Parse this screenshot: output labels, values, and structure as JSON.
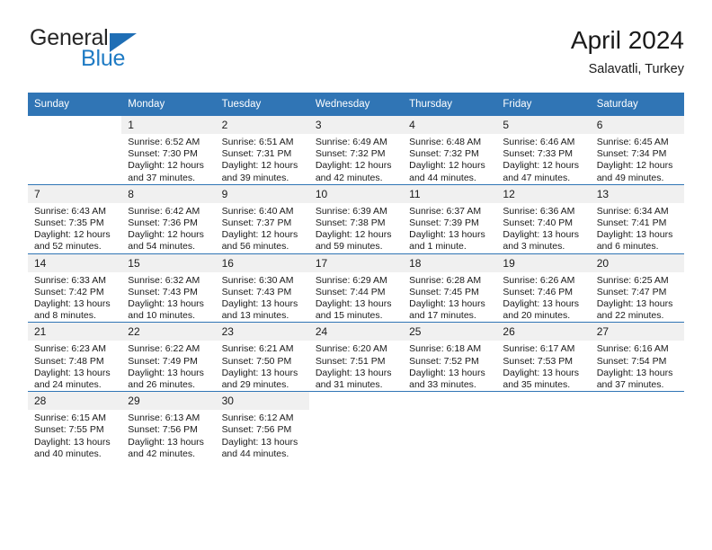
{
  "brand": {
    "line1": "General",
    "line2": "Blue",
    "triangle_icon": "triangle-icon",
    "colors": {
      "general": "#262626",
      "blue": "#1f7bc4",
      "triangle": "#1f6eb5"
    }
  },
  "header": {
    "title": "April 2024",
    "subtitle": "Salavatli, Turkey"
  },
  "theme": {
    "header_bg": "#3075b5",
    "header_text": "#ffffff",
    "daynum_bg": "#f0f0f0",
    "row_divider": "#3075b5"
  },
  "calendar": {
    "weekday_headers": [
      "Sunday",
      "Monday",
      "Tuesday",
      "Wednesday",
      "Thursday",
      "Friday",
      "Saturday"
    ],
    "weeks": [
      [
        {
          "day": "",
          "lines": []
        },
        {
          "day": "1",
          "lines": [
            "Sunrise: 6:52 AM",
            "Sunset: 7:30 PM",
            "Daylight: 12 hours",
            "and 37 minutes."
          ]
        },
        {
          "day": "2",
          "lines": [
            "Sunrise: 6:51 AM",
            "Sunset: 7:31 PM",
            "Daylight: 12 hours",
            "and 39 minutes."
          ]
        },
        {
          "day": "3",
          "lines": [
            "Sunrise: 6:49 AM",
            "Sunset: 7:32 PM",
            "Daylight: 12 hours",
            "and 42 minutes."
          ]
        },
        {
          "day": "4",
          "lines": [
            "Sunrise: 6:48 AM",
            "Sunset: 7:32 PM",
            "Daylight: 12 hours",
            "and 44 minutes."
          ]
        },
        {
          "day": "5",
          "lines": [
            "Sunrise: 6:46 AM",
            "Sunset: 7:33 PM",
            "Daylight: 12 hours",
            "and 47 minutes."
          ]
        },
        {
          "day": "6",
          "lines": [
            "Sunrise: 6:45 AM",
            "Sunset: 7:34 PM",
            "Daylight: 12 hours",
            "and 49 minutes."
          ]
        }
      ],
      [
        {
          "day": "7",
          "lines": [
            "Sunrise: 6:43 AM",
            "Sunset: 7:35 PM",
            "Daylight: 12 hours",
            "and 52 minutes."
          ]
        },
        {
          "day": "8",
          "lines": [
            "Sunrise: 6:42 AM",
            "Sunset: 7:36 PM",
            "Daylight: 12 hours",
            "and 54 minutes."
          ]
        },
        {
          "day": "9",
          "lines": [
            "Sunrise: 6:40 AM",
            "Sunset: 7:37 PM",
            "Daylight: 12 hours",
            "and 56 minutes."
          ]
        },
        {
          "day": "10",
          "lines": [
            "Sunrise: 6:39 AM",
            "Sunset: 7:38 PM",
            "Daylight: 12 hours",
            "and 59 minutes."
          ]
        },
        {
          "day": "11",
          "lines": [
            "Sunrise: 6:37 AM",
            "Sunset: 7:39 PM",
            "Daylight: 13 hours",
            "and 1 minute."
          ]
        },
        {
          "day": "12",
          "lines": [
            "Sunrise: 6:36 AM",
            "Sunset: 7:40 PM",
            "Daylight: 13 hours",
            "and 3 minutes."
          ]
        },
        {
          "day": "13",
          "lines": [
            "Sunrise: 6:34 AM",
            "Sunset: 7:41 PM",
            "Daylight: 13 hours",
            "and 6 minutes."
          ]
        }
      ],
      [
        {
          "day": "14",
          "lines": [
            "Sunrise: 6:33 AM",
            "Sunset: 7:42 PM",
            "Daylight: 13 hours",
            "and 8 minutes."
          ]
        },
        {
          "day": "15",
          "lines": [
            "Sunrise: 6:32 AM",
            "Sunset: 7:43 PM",
            "Daylight: 13 hours",
            "and 10 minutes."
          ]
        },
        {
          "day": "16",
          "lines": [
            "Sunrise: 6:30 AM",
            "Sunset: 7:43 PM",
            "Daylight: 13 hours",
            "and 13 minutes."
          ]
        },
        {
          "day": "17",
          "lines": [
            "Sunrise: 6:29 AM",
            "Sunset: 7:44 PM",
            "Daylight: 13 hours",
            "and 15 minutes."
          ]
        },
        {
          "day": "18",
          "lines": [
            "Sunrise: 6:28 AM",
            "Sunset: 7:45 PM",
            "Daylight: 13 hours",
            "and 17 minutes."
          ]
        },
        {
          "day": "19",
          "lines": [
            "Sunrise: 6:26 AM",
            "Sunset: 7:46 PM",
            "Daylight: 13 hours",
            "and 20 minutes."
          ]
        },
        {
          "day": "20",
          "lines": [
            "Sunrise: 6:25 AM",
            "Sunset: 7:47 PM",
            "Daylight: 13 hours",
            "and 22 minutes."
          ]
        }
      ],
      [
        {
          "day": "21",
          "lines": [
            "Sunrise: 6:23 AM",
            "Sunset: 7:48 PM",
            "Daylight: 13 hours",
            "and 24 minutes."
          ]
        },
        {
          "day": "22",
          "lines": [
            "Sunrise: 6:22 AM",
            "Sunset: 7:49 PM",
            "Daylight: 13 hours",
            "and 26 minutes."
          ]
        },
        {
          "day": "23",
          "lines": [
            "Sunrise: 6:21 AM",
            "Sunset: 7:50 PM",
            "Daylight: 13 hours",
            "and 29 minutes."
          ]
        },
        {
          "day": "24",
          "lines": [
            "Sunrise: 6:20 AM",
            "Sunset: 7:51 PM",
            "Daylight: 13 hours",
            "and 31 minutes."
          ]
        },
        {
          "day": "25",
          "lines": [
            "Sunrise: 6:18 AM",
            "Sunset: 7:52 PM",
            "Daylight: 13 hours",
            "and 33 minutes."
          ]
        },
        {
          "day": "26",
          "lines": [
            "Sunrise: 6:17 AM",
            "Sunset: 7:53 PM",
            "Daylight: 13 hours",
            "and 35 minutes."
          ]
        },
        {
          "day": "27",
          "lines": [
            "Sunrise: 6:16 AM",
            "Sunset: 7:54 PM",
            "Daylight: 13 hours",
            "and 37 minutes."
          ]
        }
      ],
      [
        {
          "day": "28",
          "lines": [
            "Sunrise: 6:15 AM",
            "Sunset: 7:55 PM",
            "Daylight: 13 hours",
            "and 40 minutes."
          ]
        },
        {
          "day": "29",
          "lines": [
            "Sunrise: 6:13 AM",
            "Sunset: 7:56 PM",
            "Daylight: 13 hours",
            "and 42 minutes."
          ]
        },
        {
          "day": "30",
          "lines": [
            "Sunrise: 6:12 AM",
            "Sunset: 7:56 PM",
            "Daylight: 13 hours",
            "and 44 minutes."
          ]
        },
        {
          "day": "",
          "lines": []
        },
        {
          "day": "",
          "lines": []
        },
        {
          "day": "",
          "lines": []
        },
        {
          "day": "",
          "lines": []
        }
      ]
    ]
  }
}
